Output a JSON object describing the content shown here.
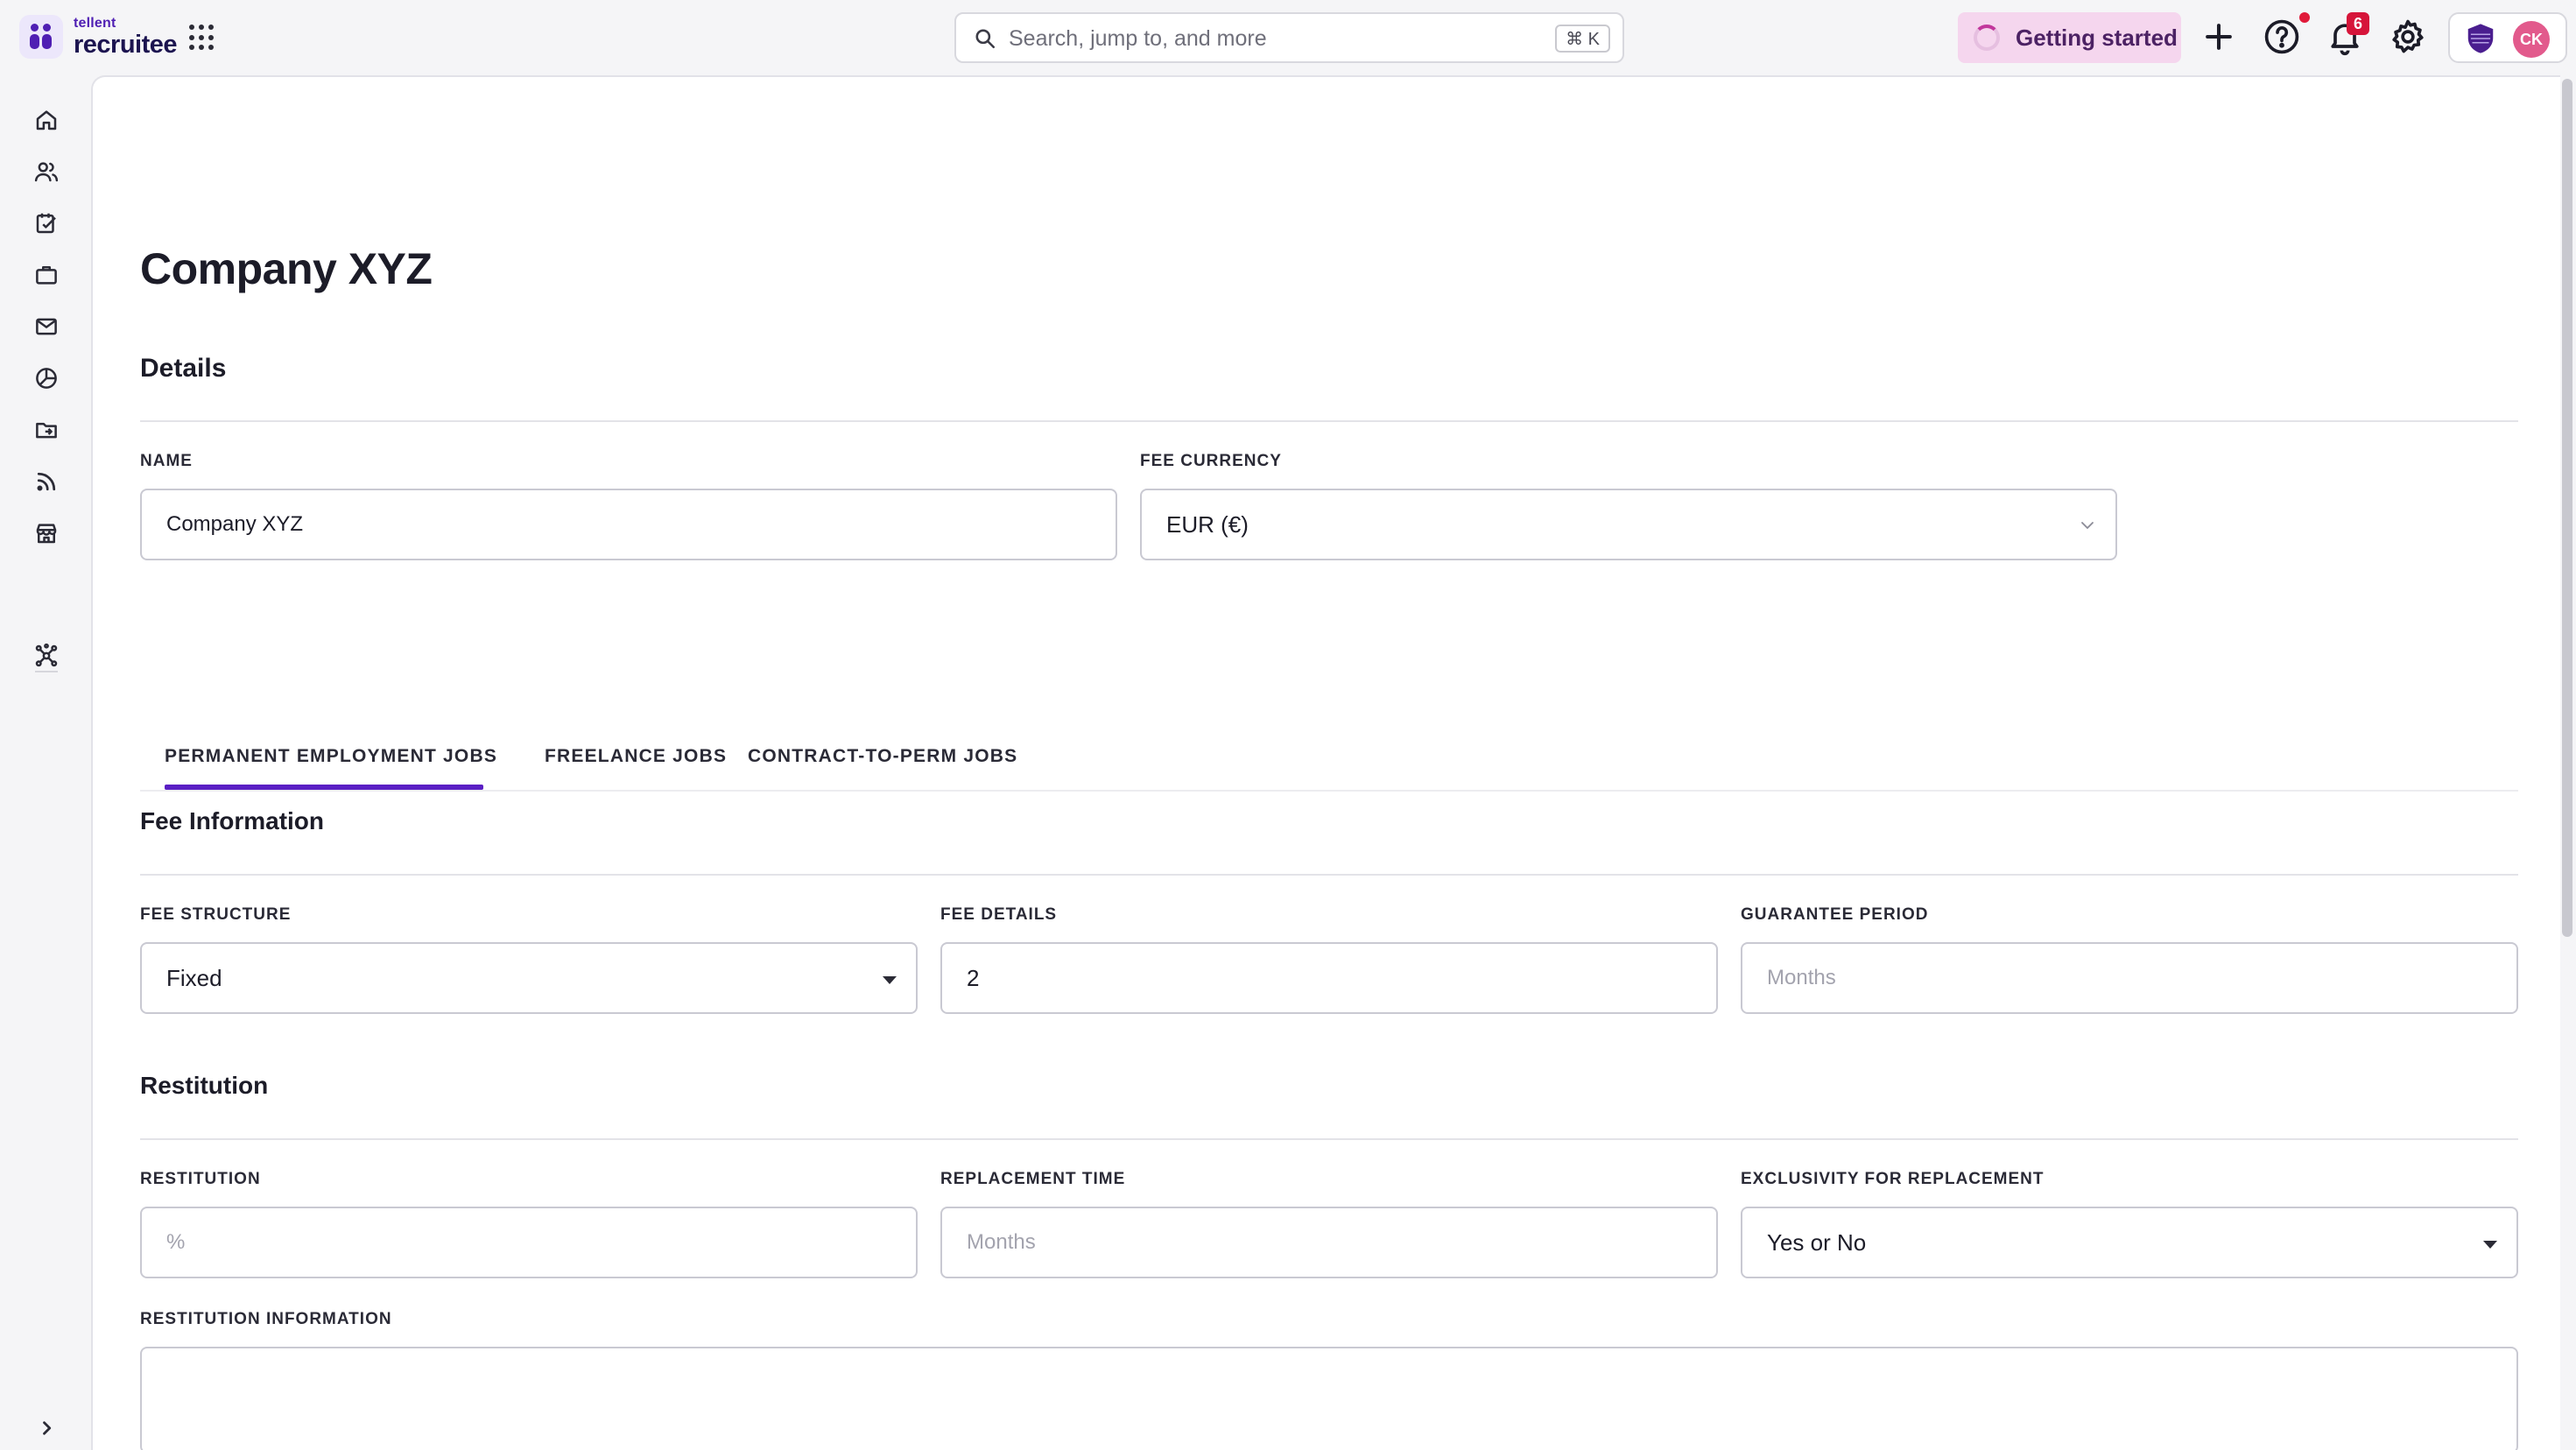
{
  "brand": {
    "small": "tellent",
    "name": "recruitee"
  },
  "search": {
    "placeholder": "Search, jump to, and more",
    "shortcut": "⌘ K"
  },
  "topbar": {
    "getting_started": "Getting started",
    "notifications_count": "6",
    "avatar_initials": "CK"
  },
  "sidebar": {
    "items": [
      "home-icon",
      "candidates-icon",
      "tasks-icon",
      "jobs-icon",
      "mail-icon",
      "reports-icon",
      "folder-icon",
      "feed-icon",
      "marketplace-icon",
      "integrations-icon"
    ],
    "expand": "chevron-right-icon"
  },
  "page": {
    "title": "Company XYZ"
  },
  "details": {
    "heading": "Details",
    "name_label": "NAME",
    "name_value": "Company XYZ",
    "currency_label": "FEE CURRENCY",
    "currency_value": "EUR (€)"
  },
  "tabs": [
    {
      "label": "PERMANENT EMPLOYMENT JOBS",
      "active": true
    },
    {
      "label": "FREELANCE JOBS",
      "active": false
    },
    {
      "label": "CONTRACT-TO-PERM JOBS",
      "active": false
    }
  ],
  "fee": {
    "heading": "Fee Information",
    "structure_label": "FEE STRUCTURE",
    "structure_value": "Fixed",
    "details_label": "FEE DETAILS",
    "details_value": "2",
    "guarantee_label": "GUARANTEE PERIOD",
    "guarantee_placeholder": "Months"
  },
  "restitution": {
    "heading": "Restitution",
    "restitution_label": "RESTITUTION",
    "restitution_placeholder": "%",
    "replacement_label": "REPLACEMENT TIME",
    "replacement_placeholder": "Months",
    "exclusivity_label": "EXCLUSIVITY FOR REPLACEMENT",
    "exclusivity_value": "Yes or No",
    "info_label": "RESTITUTION INFORMATION"
  },
  "colors": {
    "accent": "#5a1fc4",
    "getting_started_bg": "#f5d6ee",
    "badge": "#d6153a",
    "avatar": "#e25a8c"
  }
}
